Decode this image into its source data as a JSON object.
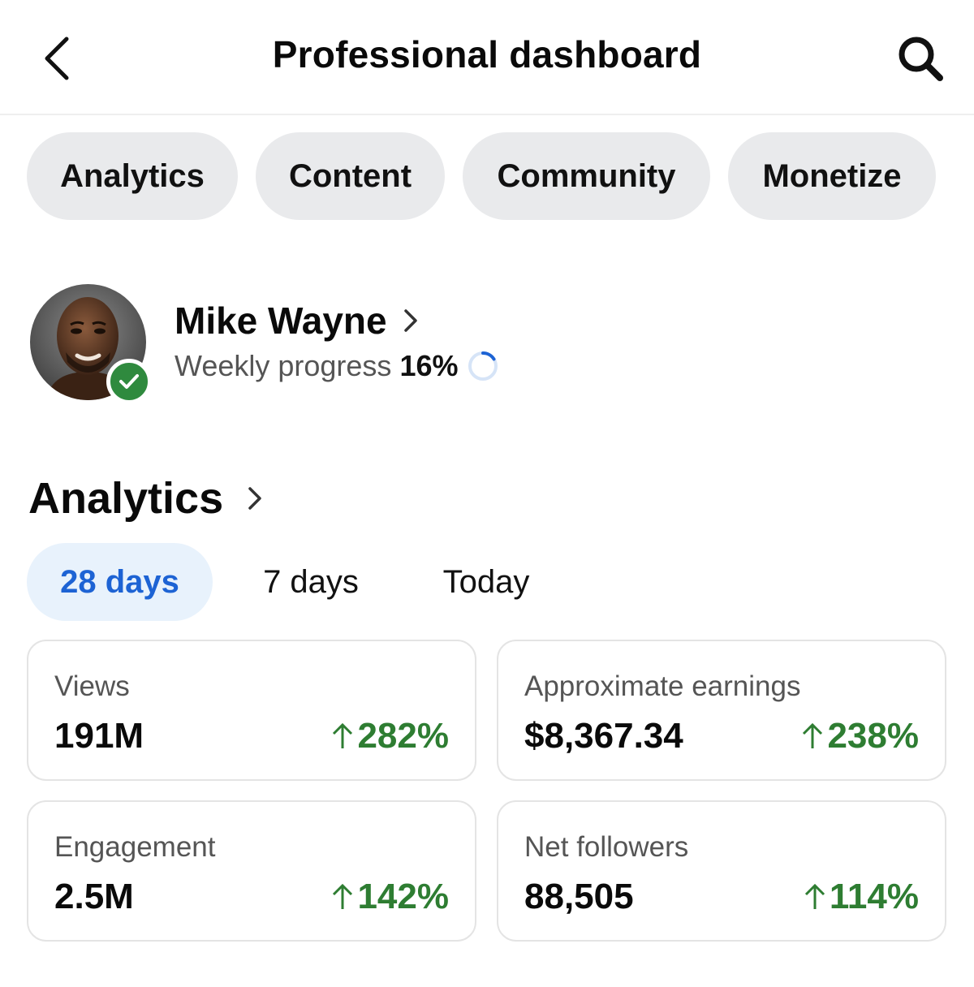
{
  "header": {
    "title": "Professional dashboard",
    "back_icon": "chevron-left-icon",
    "search_icon": "search-icon"
  },
  "tabs": [
    {
      "label": "Analytics"
    },
    {
      "label": "Content"
    },
    {
      "label": "Community"
    },
    {
      "label": "Monetize"
    }
  ],
  "profile": {
    "name": "Mike Wayne",
    "progress_label": "Weekly progress",
    "progress_value": "16%",
    "progress_fraction": 0.16,
    "verified": true
  },
  "analytics": {
    "title": "Analytics",
    "ranges": [
      {
        "label": "28 days",
        "active": true
      },
      {
        "label": "7 days",
        "active": false
      },
      {
        "label": "Today",
        "active": false
      }
    ],
    "cards": [
      {
        "label": "Views",
        "value": "191M",
        "change": "282%"
      },
      {
        "label": "Approximate earnings",
        "value": "$8,367.34",
        "change": "238%"
      },
      {
        "label": "Engagement",
        "value": "2.5M",
        "change": "142%"
      },
      {
        "label": "Net followers",
        "value": "88,505",
        "change": "114%"
      }
    ]
  },
  "colors": {
    "accent": "#1d63d4",
    "positive": "#2e7d32",
    "pill_bg": "#e9eaec",
    "active_range_bg": "#e8f2fc",
    "verified": "#2f8a3e"
  }
}
